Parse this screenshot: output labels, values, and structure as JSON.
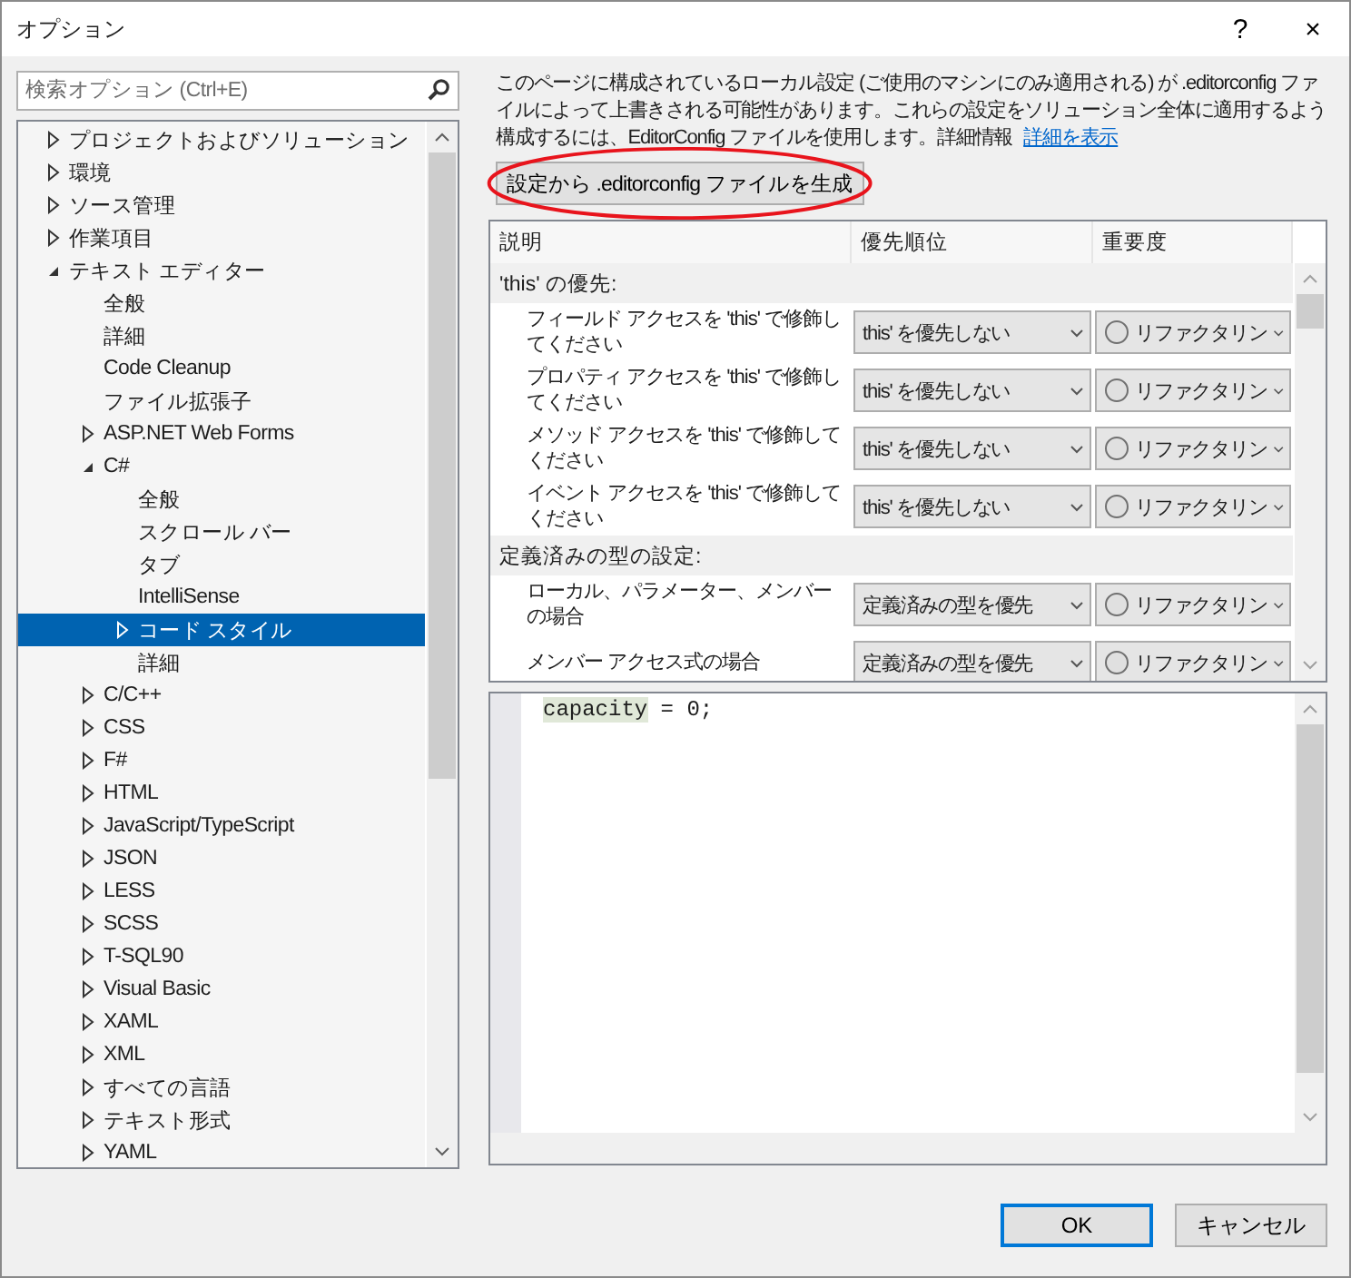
{
  "window": {
    "title": "オプション",
    "help": "?",
    "close": "×"
  },
  "search": {
    "placeholder": "検索オプション (Ctrl+E)"
  },
  "tree": [
    {
      "label": "プロジェクトおよびソリューション",
      "expanded": false,
      "selected": false
    },
    {
      "label": "環境",
      "expanded": false,
      "selected": false
    },
    {
      "label": "ソース管理",
      "expanded": false,
      "selected": false
    },
    {
      "label": "作業項目",
      "expanded": false,
      "selected": false
    },
    {
      "label": "テキスト エディター",
      "expanded": true,
      "selected": false,
      "children": [
        {
          "label": "全般",
          "selected": false
        },
        {
          "label": "詳細",
          "selected": false
        },
        {
          "label": "Code Cleanup",
          "selected": false
        },
        {
          "label": "ファイル拡張子",
          "selected": false
        },
        {
          "label": "ASP.NET Web Forms",
          "expanded": false,
          "selected": false
        },
        {
          "label": "C#",
          "expanded": true,
          "selected": false,
          "children": [
            {
              "label": "全般",
              "selected": false
            },
            {
              "label": "スクロール バー",
              "selected": false
            },
            {
              "label": "タブ",
              "selected": false
            },
            {
              "label": "IntelliSense",
              "selected": false
            },
            {
              "label": "コード スタイル",
              "expanded": false,
              "selected": true
            },
            {
              "label": "詳細",
              "selected": false
            }
          ]
        },
        {
          "label": "C/C++",
          "expanded": false,
          "selected": false
        },
        {
          "label": "CSS",
          "expanded": false,
          "selected": false
        },
        {
          "label": "F#",
          "expanded": false,
          "selected": false
        },
        {
          "label": "HTML",
          "expanded": false,
          "selected": false
        },
        {
          "label": "JavaScript/TypeScript",
          "expanded": false,
          "selected": false
        },
        {
          "label": "JSON",
          "expanded": false,
          "selected": false
        },
        {
          "label": "LESS",
          "expanded": false,
          "selected": false
        },
        {
          "label": "SCSS",
          "expanded": false,
          "selected": false
        },
        {
          "label": "T-SQL90",
          "expanded": false,
          "selected": false
        },
        {
          "label": "Visual Basic",
          "expanded": false,
          "selected": false
        },
        {
          "label": "XAML",
          "expanded": false,
          "selected": false
        },
        {
          "label": "XML",
          "expanded": false,
          "selected": false
        },
        {
          "label": "すべての言語",
          "expanded": false,
          "selected": false
        },
        {
          "label": "テキスト形式",
          "expanded": false,
          "selected": false
        },
        {
          "label": "YAML",
          "expanded": false,
          "selected": false
        }
      ]
    }
  ],
  "info": {
    "text": "このページに構成されているローカル設定 (ご使用のマシンにのみ適用される) が .editorconfig ファイルによって上書きされる可能性があります。これらの設定をソリューション全体に適用するよう構成するには、EditorConfig ファイルを使用します。詳細情報",
    "link": "詳細を表示"
  },
  "generate_button": "設定から .editorconfig ファイルを生成",
  "table": {
    "columns": [
      "説明",
      "優先順位",
      "重要度"
    ],
    "groups": [
      {
        "title": "'this' の優先:",
        "rows": [
          {
            "description": "フィールド アクセスを 'this' で修飾してください",
            "priority": "this' を優先しない",
            "severity": "リファクタリン"
          },
          {
            "description": "プロパティ アクセスを 'this' で修飾してください",
            "priority": "this' を優先しない",
            "severity": "リファクタリン"
          },
          {
            "description": "メソッド アクセスを 'this' で修飾してください",
            "priority": "this' を優先しない",
            "severity": "リファクタリン"
          },
          {
            "description": "イベント アクセスを 'this' で修飾してください",
            "priority": "this' を優先しない",
            "severity": "リファクタリン"
          }
        ]
      },
      {
        "title": "定義済みの型の設定:",
        "rows": [
          {
            "description": "ローカル、パラメーター、メンバーの場合",
            "priority": "定義済みの型を優先",
            "severity": "リファクタリン"
          },
          {
            "description": "メンバー アクセス式の場合",
            "priority": "定義済みの型を優先",
            "severity": "リファクタリン"
          }
        ]
      }
    ]
  },
  "code_preview": {
    "highlight": "capacity",
    "rest": " = 0;"
  },
  "buttons": [
    "OK",
    "キャンセル"
  ]
}
